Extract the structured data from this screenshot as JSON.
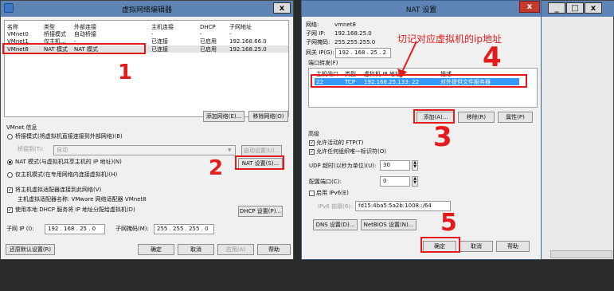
{
  "vne": {
    "title": "虚拟网络编辑器",
    "close": "x",
    "headers": [
      "名称",
      "类型",
      "外部连接",
      "主机连接",
      "DHCP",
      "子网地址"
    ],
    "rows": [
      [
        "VMnet0",
        "桥接模式",
        "自动桥接",
        "-",
        "-",
        "-"
      ],
      [
        "VMnet1",
        "仅主机...",
        "-",
        "已连接",
        "已启用",
        "192.168.66.0"
      ],
      [
        "VMnet8",
        "NAT 模式",
        "NAT 模式",
        "已连接",
        "已启用",
        "192.168.25.0"
      ]
    ],
    "add_network": "添加网络(E)...",
    "remove_network": "移除网络(O)",
    "vmnet_info": "VMnet 信息",
    "bridged_mode": "桥接模式(将虚拟机直接连接到外部网络)(B)",
    "bridged_to_label": "桥接到(T):",
    "bridged_to_value": "自动",
    "auto_settings": "自动设置(U)...",
    "nat_mode": "NAT 模式(与虚拟机共享主机的 IP 地址)(N)",
    "nat_settings": "NAT 设置(S)...",
    "host_only": "仅主机模式(在专用网络内连接虚拟机)(H)",
    "connect_adapter": "将主机虚拟适配器连接到此网络(V)",
    "adapter_name": "主机虚拟适配器名称: VMware 网络适配器 VMnet8",
    "use_dhcp": "使用本地 DHCP 服务将 IP 地址分配给虚拟机(D)",
    "dhcp_settings": "DHCP 设置(P)...",
    "subnet_ip_label": "子网 IP (I):",
    "subnet_ip": "192 . 168 . 25 . 0",
    "subnet_mask_label": "子网掩码(M):",
    "subnet_mask": "255 . 255 . 255 . 0",
    "restore_defaults": "还原默认设置(R)",
    "ok": "确定",
    "cancel": "取消",
    "apply": "应用(A)",
    "help": "帮助"
  },
  "nat": {
    "title": "NAT 设置",
    "close": "x",
    "network_label": "网络:",
    "network_value": "vmnet8",
    "subnet_ip_label": "子网 IP:",
    "subnet_ip_value": "192.168.25.0",
    "subnet_mask_label": "子网掩码:",
    "subnet_mask_value": "255.255.255.0",
    "gateway_label": "网关 IP(G):",
    "gateway_value": "192 . 168 . 25 . 2",
    "port_forward_label": "端口转发(F)",
    "pf_headers": [
      "主机端口",
      "类型",
      "虚拟机 IP 地址",
      "描述"
    ],
    "pf_row": [
      "22",
      "TCP",
      "192.168.25.133: 22",
      "对外提供文件服务器"
    ],
    "add": "添加(A)...",
    "remove": "移除(R)",
    "properties": "属性(P)",
    "advanced": "高级",
    "allow_ftp": "允许活动的 FTP(T)",
    "allow_oui": "允许任何组织唯一标识符(O)",
    "udp_label": "UDP 超时(以秒为单位)(U):",
    "udp_value": "30",
    "config_port_label": "配置端口(C):",
    "config_port_value": "0",
    "enable_ipv6": "启用 IPv6(E)",
    "ipv6_prefix_label": "IPv6 前缀(6):",
    "ipv6_prefix_value": "fd15:4ba5:5a2b:1008::/64",
    "dns_settings": "DNS 设置(D)...",
    "netbios_settings": "NetBIOS 设置(N)...",
    "ok": "确定",
    "cancel": "取消",
    "help": "帮助"
  },
  "third": {
    "min": "_",
    "max": "□",
    "close": "x"
  },
  "annotations": {
    "note": "切记对应虚拟机的ip地址",
    "n1": "1",
    "n2": "2",
    "n3": "3",
    "n4": "4",
    "n5": "5",
    "color": "#e41b1b"
  }
}
